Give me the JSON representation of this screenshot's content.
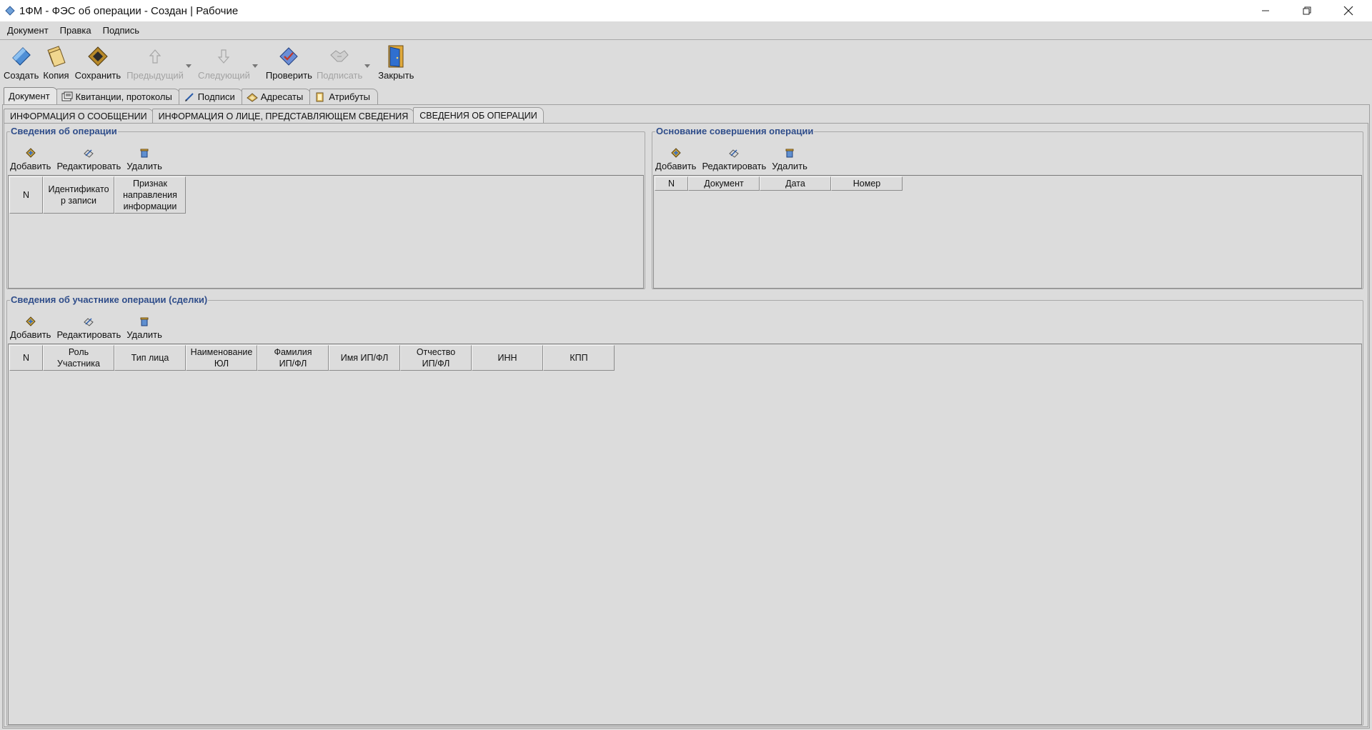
{
  "window": {
    "title": "1ФМ - ФЭС об операции - Создан | Рабочие"
  },
  "menu": [
    "Документ",
    "Правка",
    "Подпись"
  ],
  "toolbar": {
    "create": "Создать",
    "copy": "Копия",
    "save": "Сохранить",
    "previous": "Предыдущий",
    "next": "Следующий",
    "check": "Проверить",
    "sign": "Подписать",
    "close": "Закрыть"
  },
  "main_tabs": [
    "Документ",
    "Квитанции, протоколы",
    "Подписи",
    "Адресаты",
    "Атрибуты"
  ],
  "sub_tabs": [
    "ИНФОРМАЦИЯ О СООБЩЕНИИ",
    "ИНФОРМАЦИЯ О ЛИЦЕ, ПРЕДСТАВЛЯЮЩЕМ СВЕДЕНИЯ",
    "СВЕДЕНИЯ ОБ ОПЕРАЦИИ"
  ],
  "actions": {
    "add": "Добавить",
    "edit": "Редактировать",
    "delete": "Удалить"
  },
  "operations_group": {
    "title": "Сведения об операции",
    "columns": [
      "N",
      "Идентификато\nр записи",
      "Признак\nнаправления\nинформации"
    ]
  },
  "basis_group": {
    "title": "Основание совершения операции",
    "columns": [
      "N",
      "Документ",
      "Дата",
      "Номер"
    ]
  },
  "participants_group": {
    "title": "Сведения об участнике операции (сделки)",
    "columns": [
      "N",
      "Роль\nУчастника",
      "Тип лица",
      "Наименование\nЮЛ",
      "Фамилия\nИП/ФЛ",
      "Имя ИП/ФЛ",
      "Отчество\nИП/ФЛ",
      "ИНН",
      "КПП"
    ]
  }
}
